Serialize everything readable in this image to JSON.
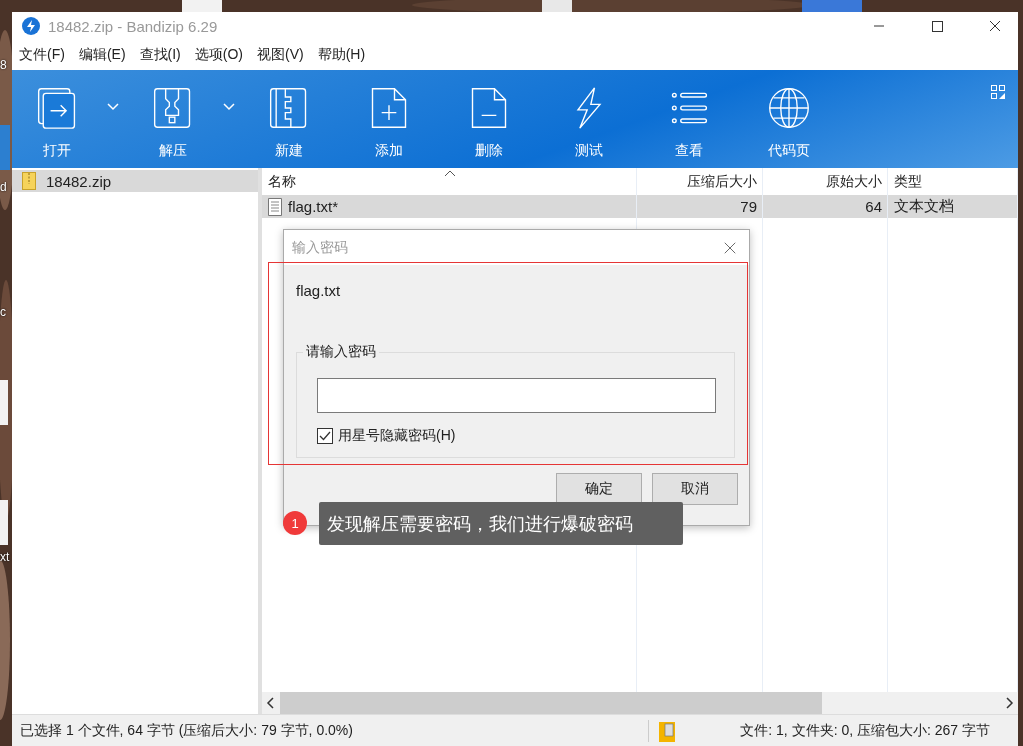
{
  "desktop_labels": [
    "8",
    "d",
    "c",
    "xt"
  ],
  "window": {
    "title": "18482.zip - Bandizip 6.29"
  },
  "menu": [
    "文件(F)",
    "编辑(E)",
    "查找(I)",
    "选项(O)",
    "视图(V)",
    "帮助(H)"
  ],
  "toolbar": [
    {
      "kind": "open",
      "label": "打开",
      "dropdown": true
    },
    {
      "kind": "extract",
      "label": "解压",
      "dropdown": true
    },
    {
      "kind": "new",
      "label": "新建",
      "dropdown": false
    },
    {
      "kind": "add",
      "label": "添加",
      "dropdown": false
    },
    {
      "kind": "delete",
      "label": "删除",
      "dropdown": false
    },
    {
      "kind": "test",
      "label": "测试",
      "dropdown": false
    },
    {
      "kind": "view",
      "label": "查看",
      "dropdown": false
    },
    {
      "kind": "codepage",
      "label": "代码页",
      "dropdown": false
    }
  ],
  "tree": [
    {
      "label": "18482.zip",
      "selected": true
    }
  ],
  "table": {
    "columns": [
      "名称",
      "压缩后大小",
      "原始大小",
      "类型"
    ],
    "rows": [
      {
        "cells": [
          "flag.txt*",
          "79",
          "64",
          "文本文档"
        ],
        "selected": true
      }
    ]
  },
  "dialog": {
    "title": "输入密码",
    "file": "flag.txt",
    "group_label": "请输入密码",
    "checkbox": {
      "label": "用星号隐藏密码(H)",
      "checked": true
    },
    "buttons": [
      "确定",
      "取消"
    ]
  },
  "annotation": {
    "number": "1",
    "text": "发现解压需要密码，我们进行爆破密码"
  },
  "status_bar": {
    "left": "已选择 1 个文件, 64 字节 (压缩后大小: 79 字节, 0.0%)",
    "right": "文件: 1, 文件夹: 0, 压缩包大小: 267 字节"
  }
}
